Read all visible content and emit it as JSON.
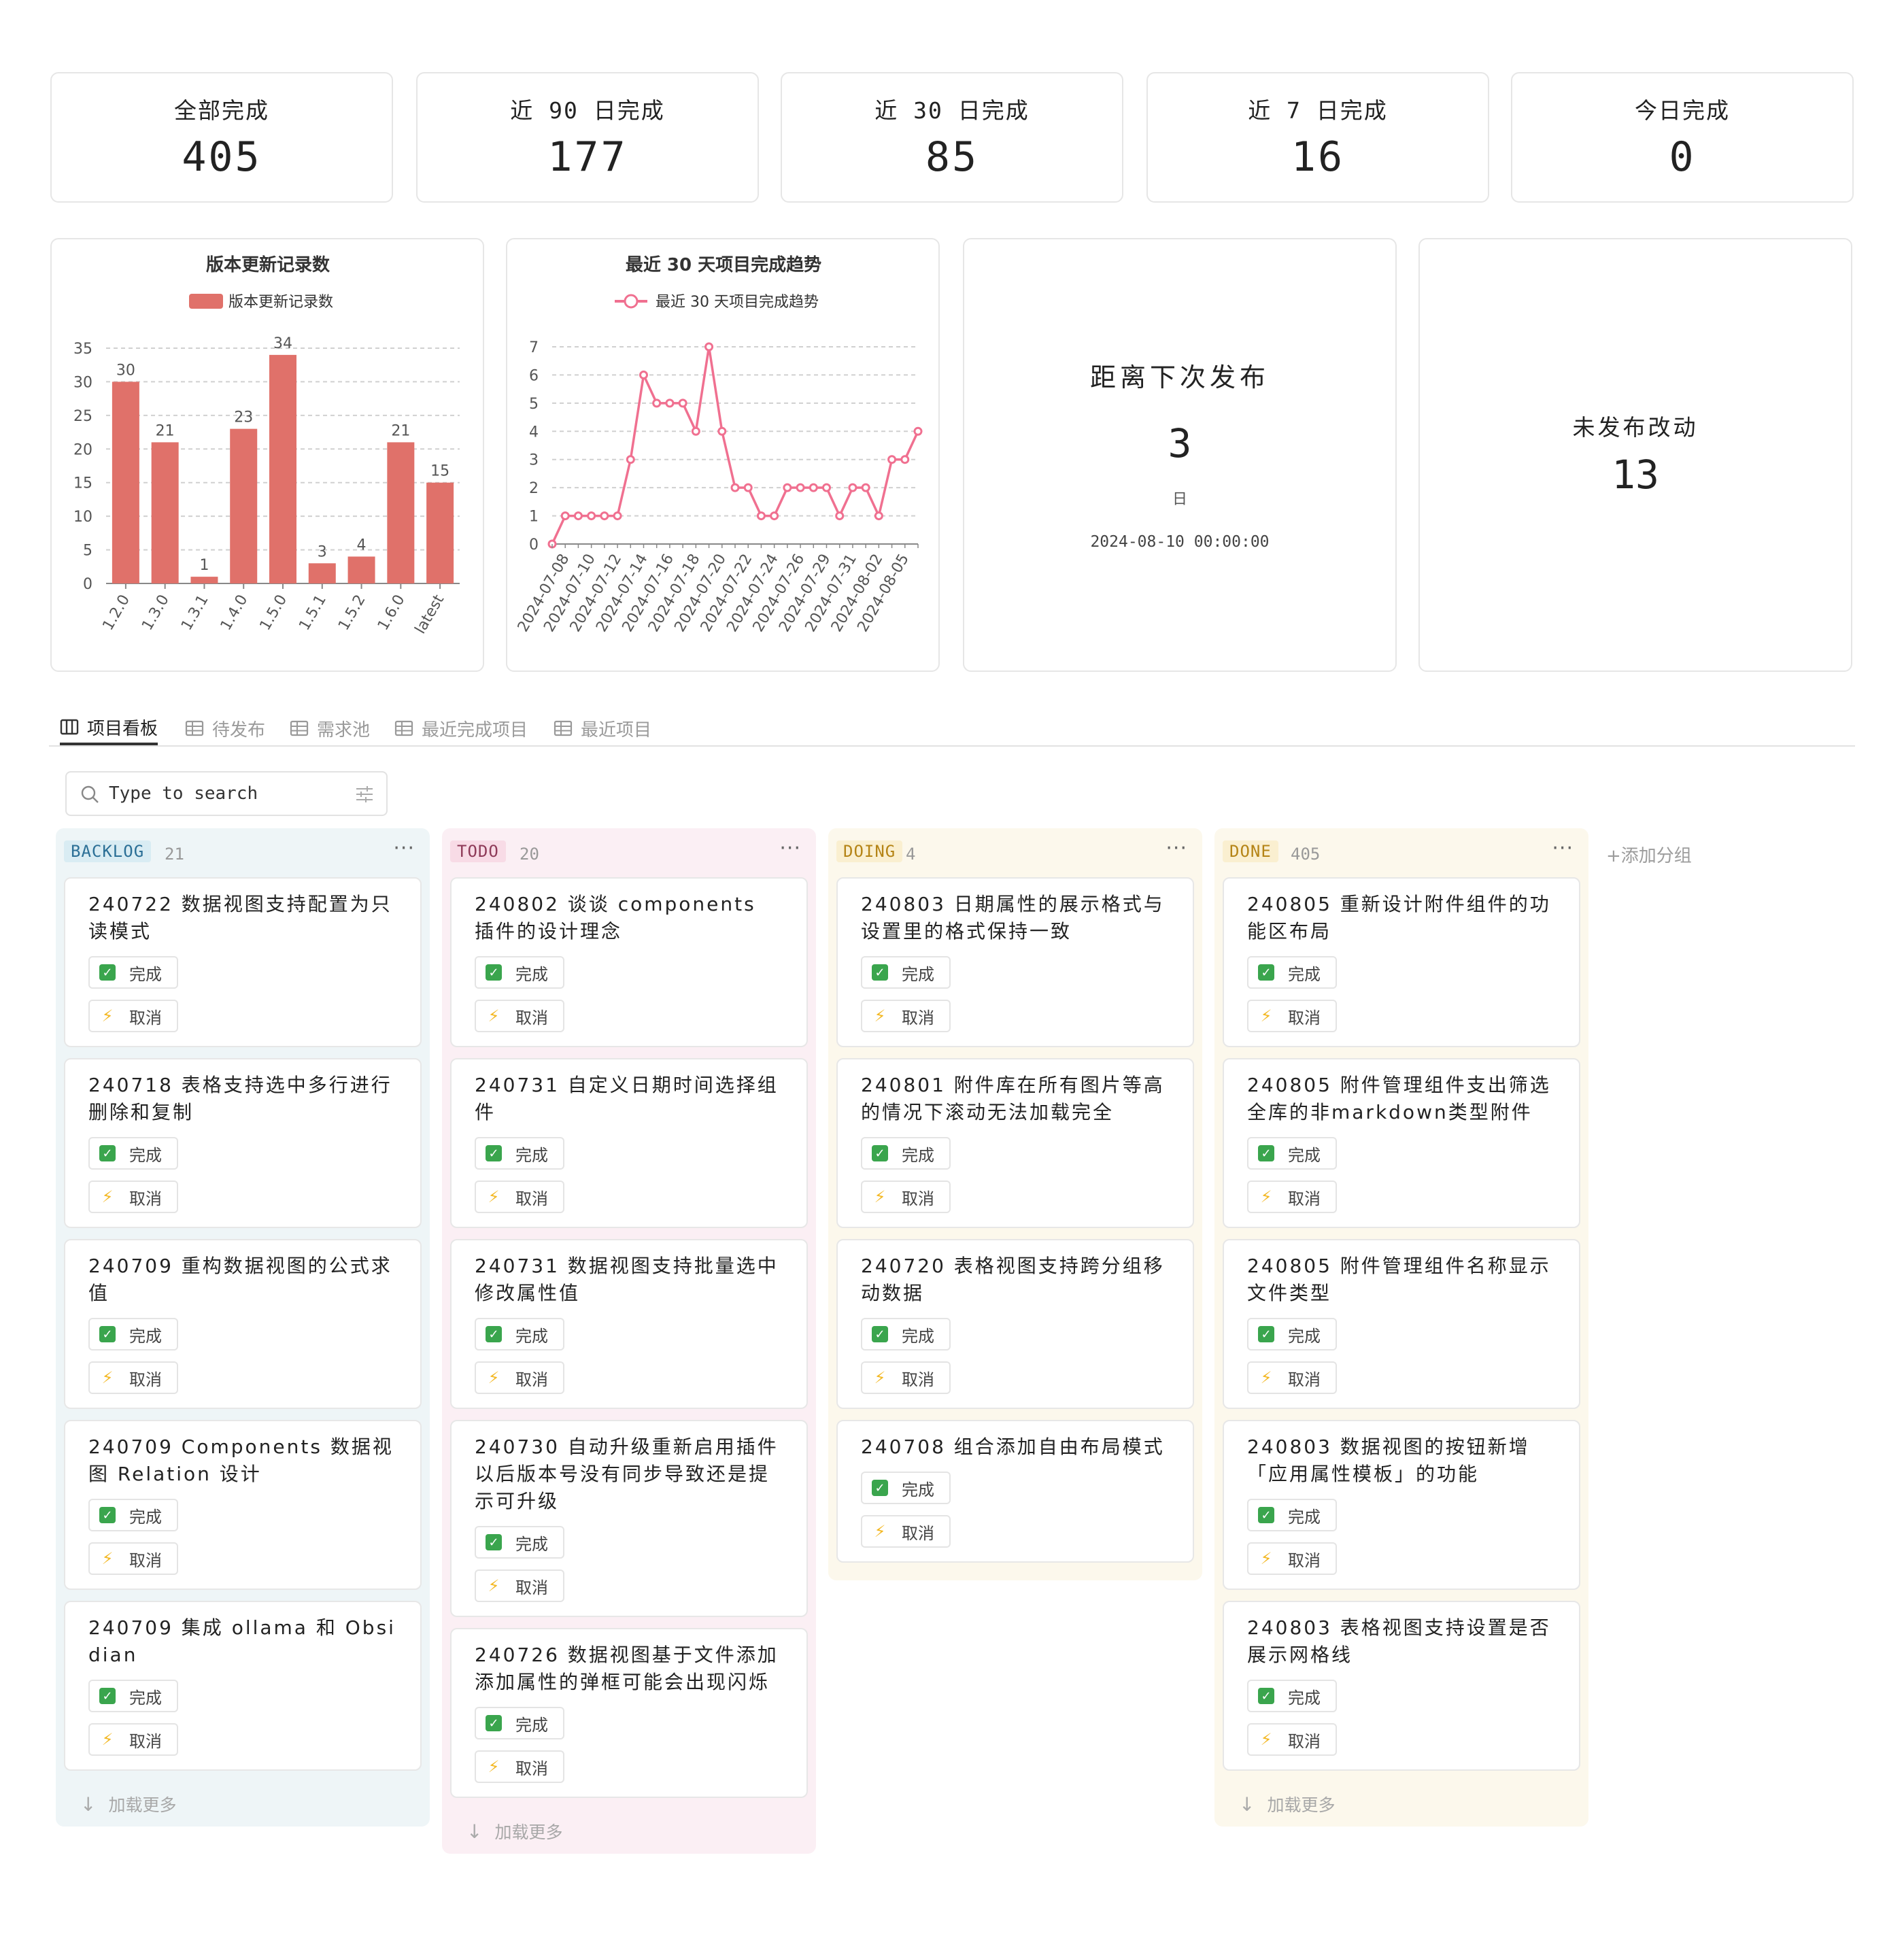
{
  "stats": [
    {
      "label": "全部完成",
      "value": "405"
    },
    {
      "label": "近 90 日完成",
      "value": "177"
    },
    {
      "label": "近 30 日完成",
      "value": "85"
    },
    {
      "label": "近 7 日完成",
      "value": "16"
    },
    {
      "label": "今日完成",
      "value": "0"
    }
  ],
  "chart_data": [
    {
      "type": "bar",
      "title": "版本更新记录数",
      "legend": [
        "版本更新记录数"
      ],
      "categories": [
        "1.2.0",
        "1.3.0",
        "1.3.1",
        "1.4.0",
        "1.5.0",
        "1.5.1",
        "1.5.2",
        "1.6.0",
        "latest"
      ],
      "values": [
        30,
        21,
        1,
        23,
        34,
        3,
        4,
        21,
        15
      ],
      "ylim": [
        0,
        35
      ],
      "yticks": [
        0,
        5,
        10,
        15,
        20,
        25,
        30,
        35
      ],
      "color": "#e0716a",
      "grid": true,
      "legend_position": "top-center"
    },
    {
      "type": "line",
      "title": "最近 30 天项目完成趋势",
      "legend": [
        "最近 30 天项目完成趋势"
      ],
      "x": [
        "2024-07-07",
        "2024-07-08",
        "2024-07-09",
        "2024-07-10",
        "2024-07-11",
        "2024-07-12",
        "2024-07-13",
        "2024-07-14",
        "2024-07-15",
        "2024-07-16",
        "2024-07-17",
        "2024-07-18",
        "2024-07-19",
        "2024-07-20",
        "2024-07-21",
        "2024-07-22",
        "2024-07-23",
        "2024-07-24",
        "2024-07-25",
        "2024-07-26",
        "2024-07-27",
        "2024-07-29",
        "2024-07-30",
        "2024-07-31",
        "2024-08-01",
        "2024-08-02",
        "2024-08-03",
        "2024-08-05",
        "2024-08-06"
      ],
      "xtick_labels": [
        "2024-07-08",
        "2024-07-10",
        "2024-07-12",
        "2024-07-14",
        "2024-07-16",
        "2024-07-18",
        "2024-07-20",
        "2024-07-22",
        "2024-07-24",
        "2024-07-26",
        "2024-07-29",
        "2024-07-31",
        "2024-08-02",
        "2024-08-05"
      ],
      "values": [
        0,
        1,
        1,
        1,
        1,
        1,
        3,
        6,
        5,
        5,
        5,
        4,
        7,
        4,
        2,
        2,
        1,
        1,
        2,
        2,
        2,
        2,
        1,
        2,
        2,
        1,
        3,
        3,
        4
      ],
      "ylim": [
        0,
        7
      ],
      "yticks": [
        0,
        1,
        2,
        3,
        4,
        5,
        6,
        7
      ],
      "color": "#f07090",
      "grid": true,
      "legend_position": "top-center"
    }
  ],
  "countdown": {
    "title": "距离下次发布",
    "value": "3",
    "unit": "日",
    "date": "2024-08-10 00:00:00"
  },
  "unreleased": {
    "title": "未发布改动",
    "value": "13"
  },
  "tabs": [
    {
      "label": "项目看板",
      "icon": "board-icon"
    },
    {
      "label": "待发布",
      "icon": "table-icon"
    },
    {
      "label": "需求池",
      "icon": "table-icon"
    },
    {
      "label": "最近完成项目",
      "icon": "table-icon"
    },
    {
      "label": "最近项目",
      "icon": "table-icon"
    }
  ],
  "search": {
    "placeholder": "Type to search"
  },
  "buttons": {
    "done": "完成",
    "cancel": "取消"
  },
  "load_more": "加载更多",
  "add_group": "+添加分组",
  "columns": [
    {
      "tag": "BACKLOG",
      "count": "21",
      "colors": {
        "bg": "#eef5f7",
        "tag_bg": "#d9ecf3",
        "tag_fg": "#2b6f96"
      },
      "cards": [
        "240722 数据视图支持配置为只读模式",
        "240718 表格支持选中多行进行删除和复制",
        "240709 重构数据视图的公式求值",
        "240709 Components 数据视图 Relation 设计",
        "240709 集成 ollama 和 Obsidian"
      ],
      "has_more": true
    },
    {
      "tag": "TODO",
      "count": "20",
      "colors": {
        "bg": "#fbeff4",
        "tag_bg": "#f8dbe6",
        "tag_fg": "#8e3a58"
      },
      "cards": [
        "240802 谈谈 components 插件的设计理念",
        "240731 自定义日期时间选择组件",
        "240731 数据视图支持批量选中修改属性值",
        "240730 自动升级重新启用插件以后版本号没有同步导致还是提示可升级",
        "240726 数据视图基于文件添加添加属性的弹框可能会出现闪烁"
      ],
      "has_more": true
    },
    {
      "tag": "DOING",
      "count": "4",
      "colors": {
        "bg": "#fcf8ec",
        "tag_bg": "#faefd0",
        "tag_fg": "#b58416"
      },
      "cards": [
        "240803 日期属性的展示格式与设置里的格式保持一致",
        "240801 附件库在所有图片等高的情况下滚动无法加载完全",
        "240720 表格视图支持跨分组移动数据",
        "240708 组合添加自由布局模式"
      ],
      "has_more": false
    },
    {
      "tag": "DONE",
      "count": "405",
      "colors": {
        "bg": "#fcf8ec",
        "tag_bg": "#faefd0",
        "tag_fg": "#b58416"
      },
      "cards": [
        "240805 重新设计附件组件的功能区布局",
        "240805 附件管理组件支出筛选全库的非markdown类型附件",
        "240805 附件管理组件名称显示文件类型",
        "240803 数据视图的按钮新增「应用属性模板」的功能",
        "240803 表格视图支持设置是否展示网格线"
      ],
      "has_more": true
    }
  ]
}
